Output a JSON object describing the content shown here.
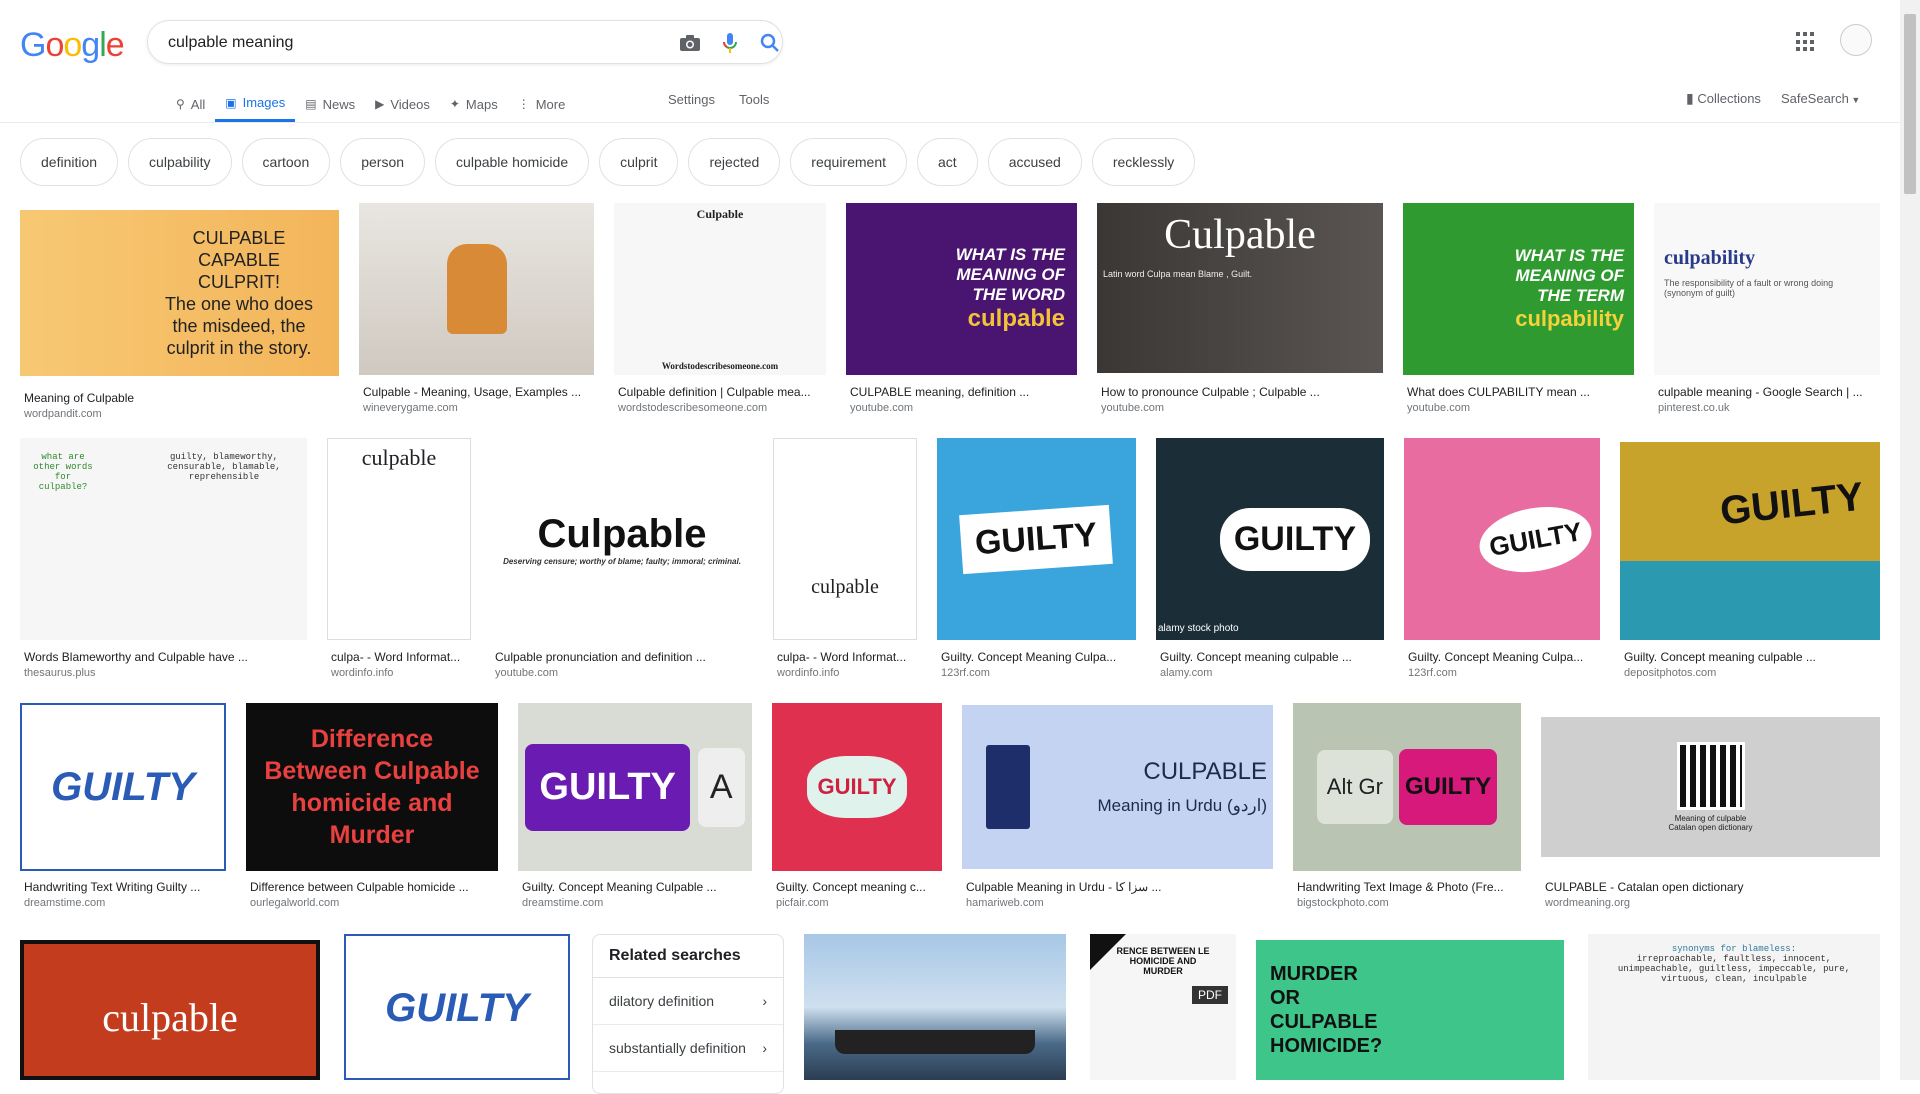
{
  "logo": {
    "g1": "G",
    "o1": "o",
    "o2": "o",
    "g2": "g",
    "l": "l",
    "e": "e"
  },
  "search": {
    "query": "culpable meaning"
  },
  "tabs": [
    {
      "label": "All",
      "icon": "search-icon"
    },
    {
      "label": "Images",
      "icon": "image-icon"
    },
    {
      "label": "News",
      "icon": "news-icon"
    },
    {
      "label": "Videos",
      "icon": "video-icon"
    },
    {
      "label": "Maps",
      "icon": "map-pin-icon"
    },
    {
      "label": "More",
      "icon": "more-vert-icon"
    }
  ],
  "tools": {
    "settings": "Settings",
    "tools": "Tools"
  },
  "right": {
    "collections": "Collections",
    "safesearch": "SafeSearch"
  },
  "chips": [
    "definition",
    "culpability",
    "cartoon",
    "person",
    "culpable homicide",
    "culprit",
    "rejected",
    "requirement",
    "act",
    "accused",
    "recklessly"
  ],
  "row1": [
    {
      "cap": "Meaning of Culpable",
      "src": "wordpandit.com",
      "text": "CULPABLE\nCAPABLE CULPRIT!\nThe one who does the misdeed, the culprit in the story."
    },
    {
      "cap": "Culpable - Meaning, Usage, Examples ...",
      "src": "wineverygame.com",
      "text": ""
    },
    {
      "cap": "Culpable definition | Culpable mea...",
      "src": "wordstodescribesomeone.com",
      "text": "Culpable",
      "text2": "Wordstodescribesomeone.com"
    },
    {
      "cap": "CULPABLE meaning, definition ...",
      "src": "youtube.com",
      "text": "WHAT IS THE MEANING OF THE WORD",
      "text2": "culpable"
    },
    {
      "cap": "How to pronounce Culpable ; Culpable ...",
      "src": "youtube.com",
      "text": "Culpable",
      "text2": "Latin word Culpa mean Blame , Guilt."
    },
    {
      "cap": "What does CULPABILITY mean ...",
      "src": "youtube.com",
      "text": "WHAT IS THE MEANING OF THE TERM",
      "text2": "culpability"
    },
    {
      "cap": "culpable meaning - Google Search | ...",
      "src": "pinterest.co.uk",
      "text": "culpability",
      "text2": "The responsibility of a fault or wrong doing (synonym of guilt)"
    }
  ],
  "row2": [
    {
      "cap": "Words Blameworthy and Culpable have ...",
      "src": "thesaurus.plus",
      "text": "what are other words for culpable?",
      "text2": "guilty, blameworthy, censurable, blamable, reprehensible"
    },
    {
      "cap": "culpa- - Word Informat...",
      "src": "wordinfo.info",
      "text": "culpable"
    },
    {
      "cap": "Culpable pronunciation and definition ...",
      "src": "youtube.com",
      "text": "Culpable",
      "text2": "Deserving censure; worthy of blame; faulty; immoral; criminal."
    },
    {
      "cap": "culpa- - Word Informat...",
      "src": "wordinfo.info",
      "text": "culpable"
    },
    {
      "cap": "Guilty. Concept Meaning Culpa...",
      "src": "123rf.com",
      "text": "GUILTY"
    },
    {
      "cap": "Guilty. Concept meaning culpable ...",
      "src": "alamy.com",
      "text": "GUILTY",
      "text2": "alamy stock photo"
    },
    {
      "cap": "Guilty. Concept Meaning Culpa...",
      "src": "123rf.com",
      "text": "GUILTY"
    },
    {
      "cap": "Guilty. Concept meaning culpable ...",
      "src": "depositphotos.com",
      "text": "GUILTY"
    }
  ],
  "row3": [
    {
      "cap": "Handwriting Text Writing Guilty ...",
      "src": "dreamstime.com",
      "text": "GUILTY"
    },
    {
      "cap": "Difference between Culpable homicide ...",
      "src": "ourlegalworld.com",
      "text": "Difference Between Culpable homicide and Murder"
    },
    {
      "cap": "Guilty. Concept Meaning Culpable ...",
      "src": "dreamstime.com",
      "text": "GUILTY",
      "text2": "A"
    },
    {
      "cap": "Guilty. Concept meaning c...",
      "src": "picfair.com",
      "text": "GUILTY"
    },
    {
      "cap": "Culpable Meaning in Urdu - سزا کا ...",
      "src": "hamariweb.com",
      "text": "CULPABLE",
      "text2": "Meaning in Urdu (اردو)"
    },
    {
      "cap": "Handwriting Text Image & Photo (Fre...",
      "src": "bigstockphoto.com",
      "text": "Alt Gr",
      "text2": "GUILTY"
    },
    {
      "cap": "CULPABLE - Catalan open dictionary",
      "src": "wordmeaning.org",
      "text": "Meaning of culpable Catalan open dictionary"
    }
  ],
  "row4": [
    {
      "text": "culpable"
    },
    {
      "text": "GUILTY"
    },
    {
      "text": ""
    },
    {
      "text": "RENCE BETWEEN LE HOMICIDE AND MURDER",
      "text2": "PDF"
    },
    {
      "text": "MURDER OR CULPABLE HOMICIDE?"
    },
    {
      "text": "synonyms for blameless:",
      "text2": "irreproachable, faultless, innocent, unimpeachable, guiltless, impeccable, pure, virtuous, clean, inculpable"
    }
  ],
  "related": {
    "title": "Related searches",
    "items": [
      "dilatory definition",
      "substantially definition"
    ]
  },
  "colors": {
    "accent": "#1a73e8",
    "blue": "#4285f4",
    "red": "#ea4335",
    "yellow": "#fbbc05",
    "green": "#34a853"
  }
}
